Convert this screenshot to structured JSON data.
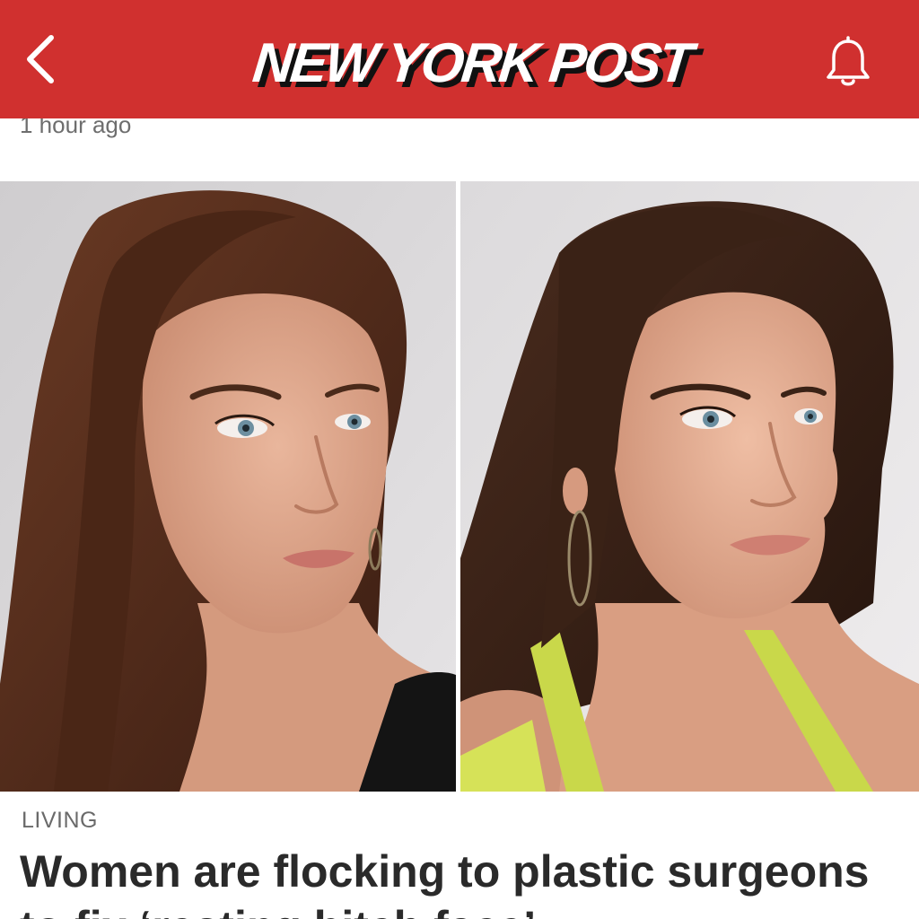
{
  "header": {
    "logo_text": "NEW YORK POST",
    "back_icon": "chevron-left-icon",
    "notifications_icon": "bell-icon",
    "brand_color": "#d0302f"
  },
  "article": {
    "timestamp": "1 hour ago",
    "section": "LIVING",
    "headline": "Women are flocking to plastic surgeons to fix ‘resting bitch face’"
  }
}
